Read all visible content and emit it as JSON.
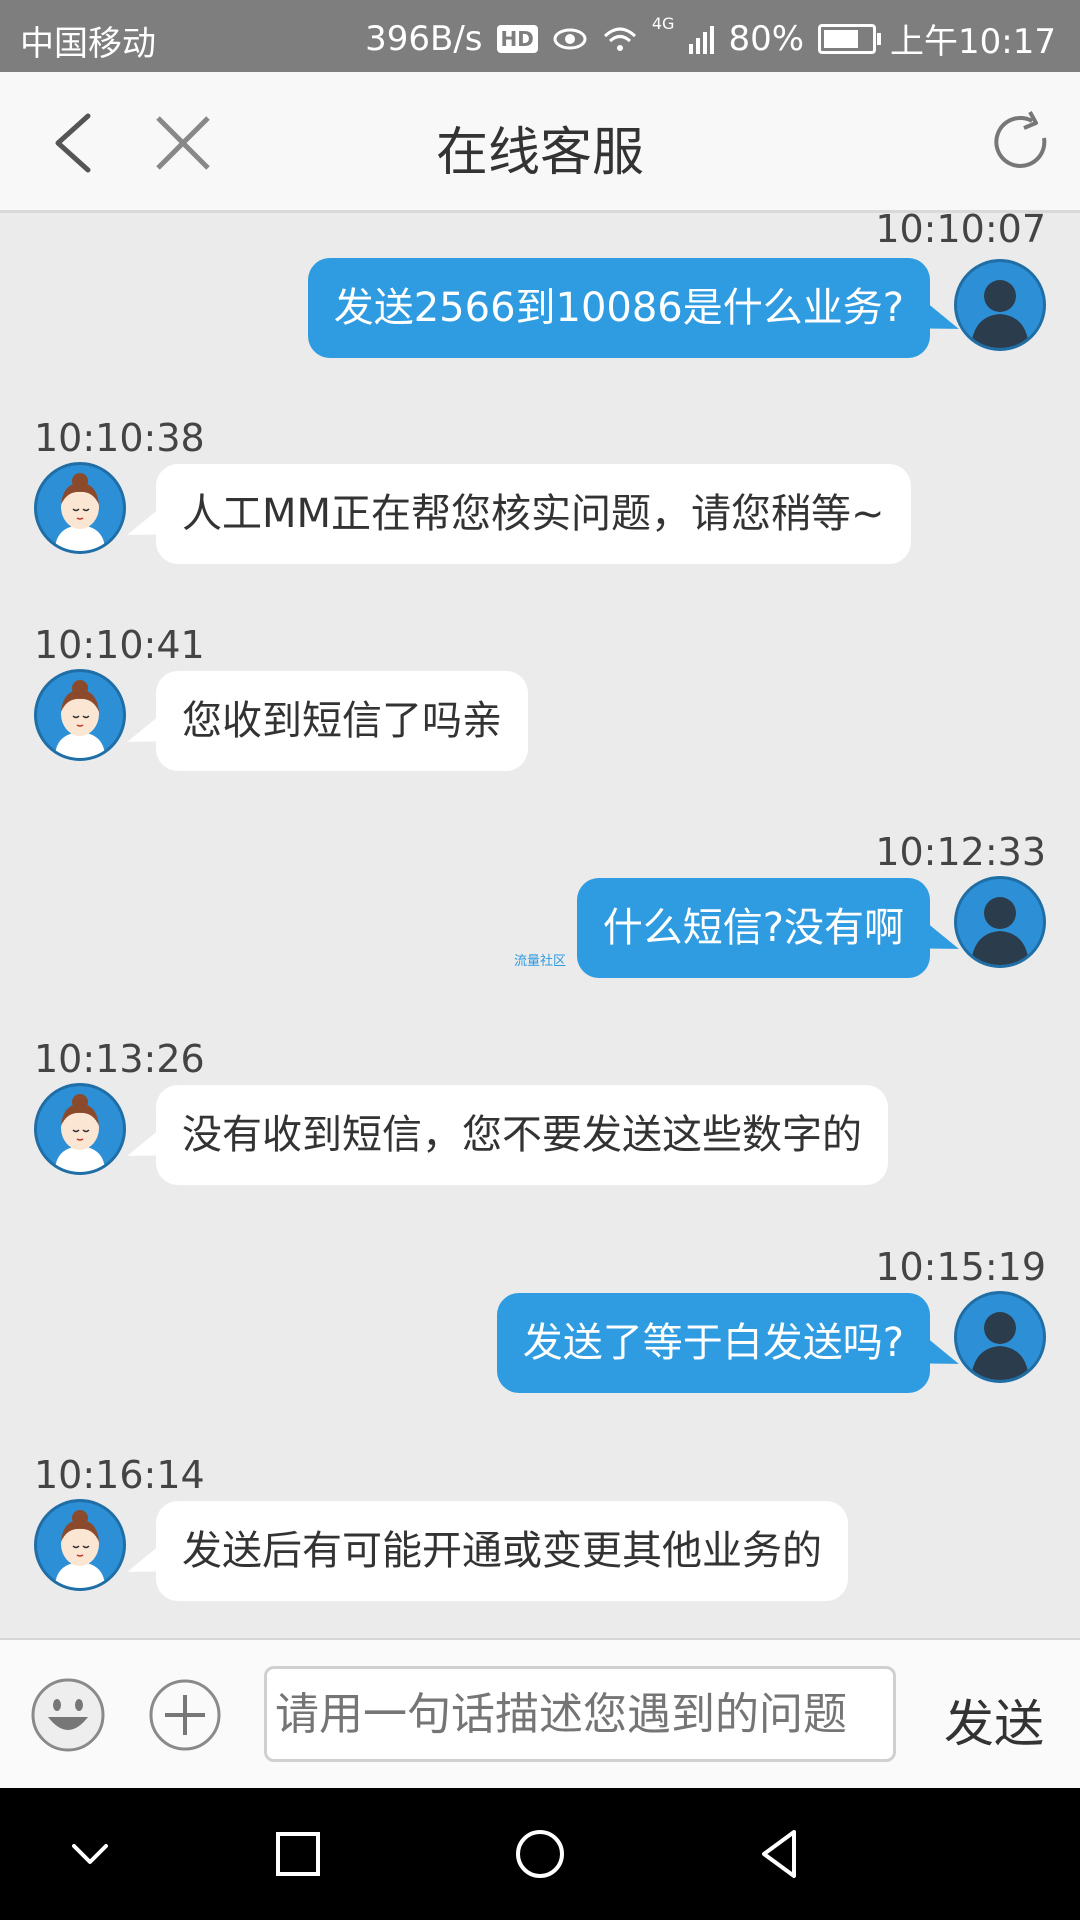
{
  "status_bar": {
    "carrier": "中国移动",
    "net_speed": "396B/s",
    "hd": "HD",
    "network_type": "4G",
    "battery": "80%",
    "battery_level": 0.8,
    "time": "上午10:17"
  },
  "header": {
    "title": "在线客服",
    "back_icon": "back-arrow-icon",
    "close_icon": "close-icon",
    "refresh_icon": "refresh-icon"
  },
  "messages": [
    {
      "sender": "user",
      "time": "10:10:07",
      "text": "发送2566到10086是什么业务?"
    },
    {
      "sender": "agent",
      "time": "10:10:38",
      "text": "人工MM正在帮您核实问题，请您稍等~"
    },
    {
      "sender": "agent",
      "time": "10:10:41",
      "text": "您收到短信了吗亲"
    },
    {
      "sender": "user",
      "time": "10:12:33",
      "text": "什么短信?没有啊"
    },
    {
      "sender": "agent",
      "time": "10:13:26",
      "text": "没有收到短信，您不要发送这些数字的"
    },
    {
      "sender": "user",
      "time": "10:15:19",
      "text": "发送了等于白发送吗?"
    },
    {
      "sender": "agent",
      "time": "10:16:14",
      "text": "发送后有可能开通或变更其他业务的"
    }
  ],
  "watermark": "流量社区",
  "input_bar": {
    "placeholder": "请用一句话描述您遇到的问题",
    "send_label": "发送"
  },
  "colors": {
    "user_bubble": "#2f9be0",
    "agent_bubble": "#ffffff",
    "chat_background": "#ebebeb"
  }
}
